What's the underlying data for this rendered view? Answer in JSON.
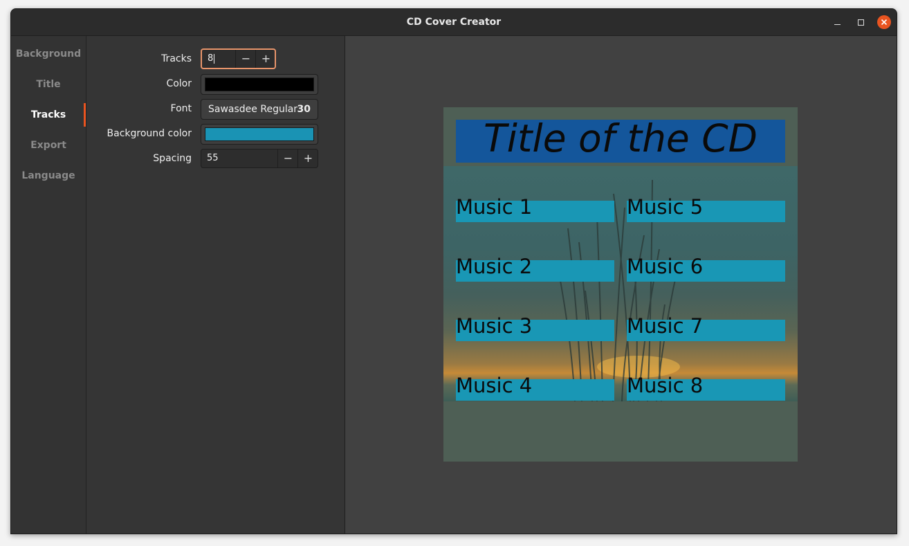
{
  "window": {
    "title": "CD Cover Creator"
  },
  "sidebar": {
    "items": [
      {
        "label": "Background"
      },
      {
        "label": "Title"
      },
      {
        "label": "Tracks"
      },
      {
        "label": "Export"
      },
      {
        "label": "Language"
      }
    ],
    "active": "Tracks"
  },
  "settings": {
    "tracks": {
      "label": "Tracks",
      "value": "8",
      "minus": "−",
      "plus": "+"
    },
    "color": {
      "label": "Color",
      "value": "#000000"
    },
    "font": {
      "label": "Font",
      "name": "Sawasdee Regular",
      "size": "30"
    },
    "background_color": {
      "label": "Background color",
      "value": "#1a93b4"
    },
    "spacing": {
      "label": "Spacing",
      "value": "55",
      "minus": "−",
      "plus": "+"
    }
  },
  "preview": {
    "title": "Title of the CD",
    "tracks": [
      "Music 1",
      "Music 2",
      "Music 3",
      "Music 4",
      "Music 5",
      "Music 6",
      "Music 7",
      "Music 8"
    ]
  },
  "colors": {
    "accent": "#e95420",
    "title_bg": "#14569b",
    "track_bg": "#1997b5"
  }
}
